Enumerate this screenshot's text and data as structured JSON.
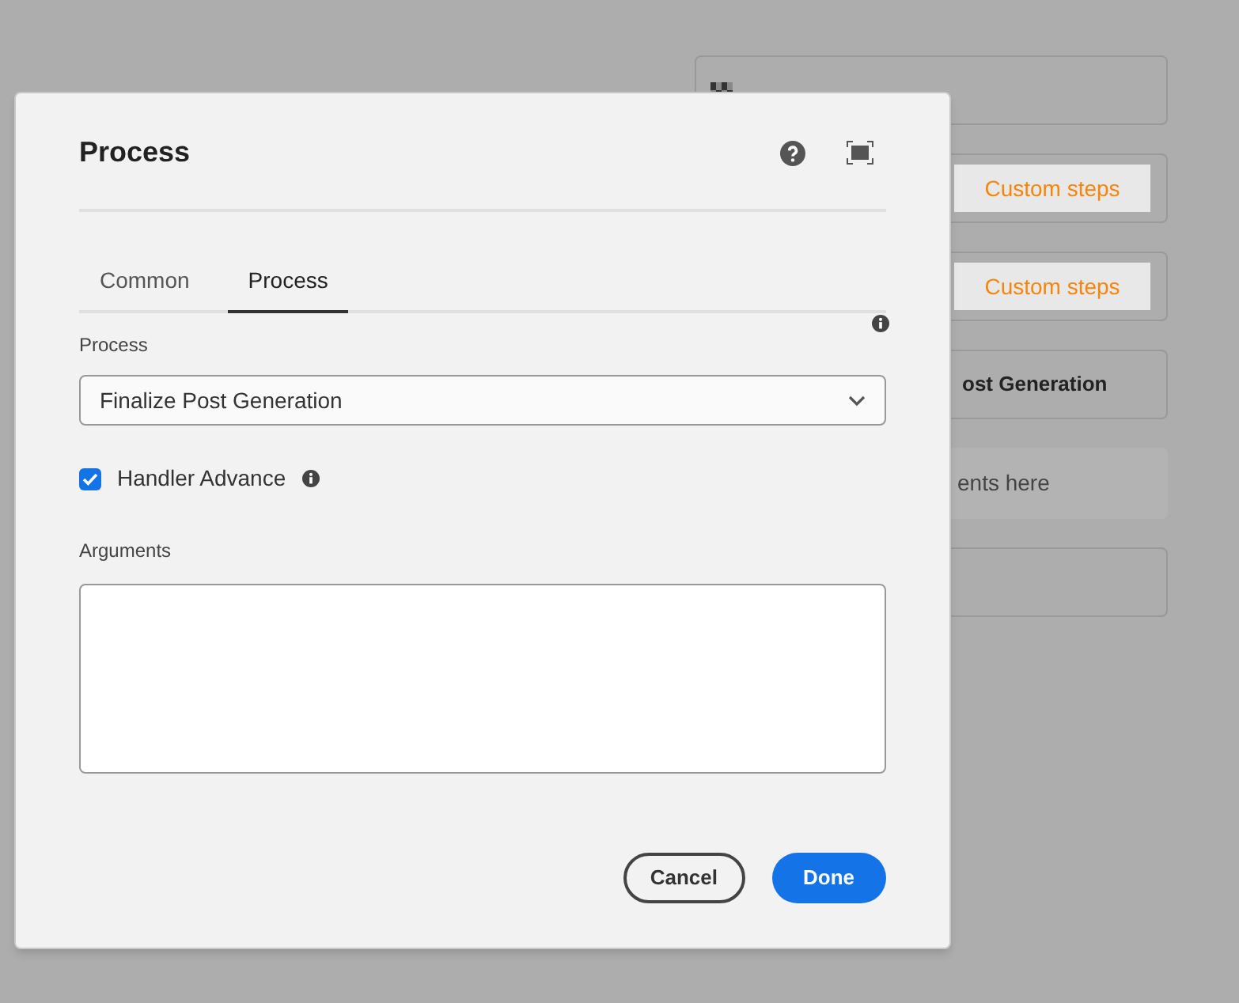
{
  "background_cards": [
    {
      "kind": "flag"
    },
    {
      "kind": "chip",
      "chip": "Custom steps"
    },
    {
      "kind": "chip",
      "chip": "Custom steps"
    },
    {
      "kind": "bold",
      "text": "ost Generation"
    },
    {
      "kind": "drop",
      "text": "ents here"
    },
    {
      "kind": "empty"
    }
  ],
  "dialog": {
    "title": "Process",
    "tabs": [
      {
        "label": "Common",
        "selected": false
      },
      {
        "label": "Process",
        "selected": true
      }
    ],
    "process_label": "Process",
    "process_select": {
      "value": "Finalize Post Generation"
    },
    "handler_advance": {
      "label": "Handler Advance",
      "checked": true
    },
    "arguments_label": "Arguments",
    "buttons": [
      {
        "label": "Cancel",
        "kind": "secondary"
      },
      {
        "label": "Done",
        "kind": "primary"
      }
    ]
  }
}
